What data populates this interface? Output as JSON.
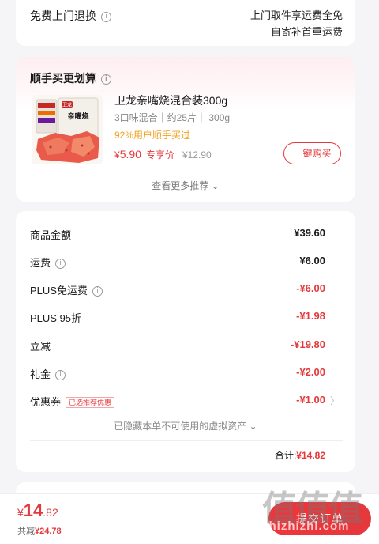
{
  "return_service": {
    "label": "免费上门退换",
    "desc_line1": "上门取件享运费全免",
    "desc_line2": "自寄补首重运费"
  },
  "combo": {
    "title": "顺手买更划算",
    "product": {
      "name": "卫龙亲嘴烧混合装300g",
      "spec": "3口味混合｜约25片｜ 300g",
      "rate_text": "92%用户顺手买过",
      "price_symbol": "¥",
      "price": "5.90",
      "price_tag": "专享价",
      "original_price": "¥12.90",
      "package_brand": "卫龙",
      "package_text": "亲嘴烧"
    },
    "buy_button": "一键购买",
    "more_label": "查看更多推荐 ⌄"
  },
  "summary": {
    "rows": [
      {
        "label": "商品金额",
        "value": "¥39.60",
        "info": false
      },
      {
        "label": "运费",
        "value": "¥6.00",
        "info": true
      },
      {
        "label": "PLUS免运费",
        "value": "-¥6.00",
        "info": true
      },
      {
        "label": "PLUS 95折",
        "value": "-¥1.98",
        "info": false
      },
      {
        "label": "立减",
        "value": "-¥19.80",
        "info": false
      },
      {
        "label": "礼金",
        "value": "-¥2.00",
        "info": true
      },
      {
        "label": "优惠券",
        "value": "-¥1.00",
        "info": false
      }
    ],
    "coupon_tag": "已选推荐优惠",
    "hidden_assets": "已隐藏本单不可使用的虚拟资产 ⌄",
    "total_label": "合计:",
    "total_value": "¥14.82"
  },
  "bottom": {
    "pay_symbol": "¥",
    "pay_int": "14",
    "pay_dec": ".82",
    "saved_label": "共减",
    "saved_value": "¥24.78",
    "submit_label": "提交订单"
  },
  "watermark": {
    "main": "值值值",
    "sub": "zhizhizhi.com"
  },
  "colors": {
    "accent_red": "#e4393c",
    "rate_orange": "#f0a21c",
    "background": "#f5f5f7"
  },
  "icons": {
    "info": "info-circle-icon",
    "chevron": "chevron-right-icon"
  }
}
